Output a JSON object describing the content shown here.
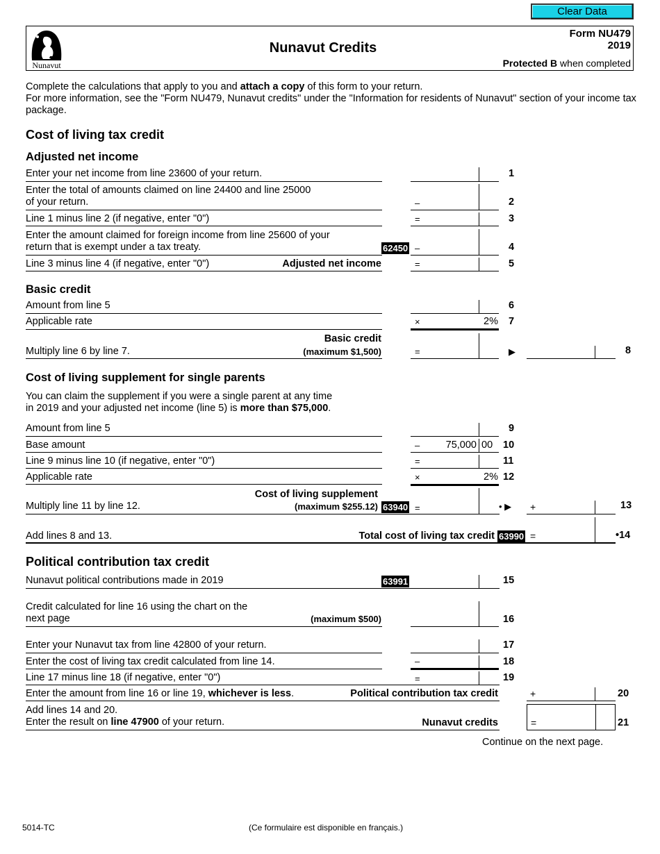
{
  "toolbar": {
    "clear_label": "Clear Data",
    "clear_color": "#1ad1e6"
  },
  "header": {
    "logo_text": "Nunavut",
    "title": "Nunavut Credits",
    "form_label": "Form NU479",
    "year": "2019",
    "protected_bold": "Protected B",
    "protected_rest": " when completed"
  },
  "intro": {
    "line1_a": "Complete the calculations that apply to you and ",
    "line1_bold": "attach a copy",
    "line1_b": " of this form to your return.",
    "line2": "For more information, see the \"Form NU479, Nunavut credits\" under the \"Information for residents of Nunavut\" section of your income tax package."
  },
  "sections": {
    "col": {
      "title": "Cost of living tax credit",
      "adj_title": "Adjusted net income",
      "basic_title": "Basic credit",
      "supp_title": "Cost of living supplement for single parents",
      "supp_desc_a": "You can claim the supplement if you were a single parent at any time",
      "supp_desc_b": "in 2019 and your adjusted net income (line 5) is ",
      "supp_desc_bold": "more than $75,000",
      "supp_desc_end": "."
    },
    "pol": {
      "title": "Political contribution tax credit"
    }
  },
  "lines": {
    "l1": {
      "num": "1",
      "label": "Enter your net income from line 23600 of your return."
    },
    "l2": {
      "num": "2",
      "label_a": "Enter the total of amounts claimed on line 24400 and line 25000",
      "label_b": "of your return.",
      "op": "–"
    },
    "l3": {
      "num": "3",
      "label": "Line 1 minus line 2 (if negative, enter \"0\")",
      "op": "="
    },
    "l4": {
      "num": "4",
      "label_a": "Enter the amount claimed for foreign income from line 25600 of your",
      "label_b": "return that is exempt under a tax treaty.",
      "code": "62450",
      "op": "–"
    },
    "l5": {
      "num": "5",
      "label": "Line 3 minus line 4 (if negative, enter \"0\")",
      "bold": "Adjusted net income",
      "op": "="
    },
    "l6": {
      "num": "6",
      "label": "Amount from line 5"
    },
    "l7": {
      "num": "7",
      "label": "Applicable rate",
      "op": "×",
      "rate": "2%"
    },
    "l8": {
      "num": "8",
      "label": "Multiply line 6 by line 7.",
      "bold_a": "Basic credit",
      "bold_b": "(maximum $1,500)",
      "op": "=",
      "arrow": "▶"
    },
    "l9": {
      "num": "9",
      "label": "Amount from line 5"
    },
    "l10": {
      "num": "10",
      "label": "Base amount",
      "op": "–",
      "value": "75,000",
      "cents": "00"
    },
    "l11": {
      "num": "11",
      "label": "Line 9 minus line 10 (if negative, enter \"0\")",
      "op": "="
    },
    "l12": {
      "num": "12",
      "label": "Applicable rate",
      "op": "×",
      "rate": "2%"
    },
    "l13": {
      "num": "13",
      "label": "Multiply line 11 by line 12.",
      "bold_a": "Cost of living supplement",
      "bold_b": "(maximum $255.12)",
      "code": "63940",
      "op": "=",
      "arrow": "• ▶",
      "op2": "+"
    },
    "l14": {
      "num": "•14",
      "label": "Add lines 8 and 13.",
      "bold": "Total cost of living tax credit",
      "code": "63990",
      "op": "="
    },
    "l15": {
      "num": "15",
      "label": "Nunavut political contributions made in 2019",
      "code": "63991"
    },
    "l16": {
      "num": "16",
      "label_a": "Credit calculated for line 16 using the chart on the",
      "label_b": "next page",
      "bold": "(maximum $500)"
    },
    "l17": {
      "num": "17",
      "label": "Enter your Nunavut tax from line 42800 of your return."
    },
    "l18": {
      "num": "18",
      "label": "Enter the cost of living tax credit calculated from line 14.",
      "op": "–"
    },
    "l19": {
      "num": "19",
      "label": "Line 17 minus line 18 (if negative, enter \"0\")",
      "op": "="
    },
    "l20": {
      "num": "20",
      "label_a": "Enter the amount from line 16 or line 19, ",
      "label_bold": "whichever is less",
      "label_end": ".",
      "bold": "Political contribution tax credit",
      "op": "+"
    },
    "l21": {
      "num": "21",
      "label_a": "Add lines 14 and 20.",
      "label_b1": "Enter the result on ",
      "label_bold": "line 47900",
      "label_b2": " of your return.",
      "bold": "Nunavut credits",
      "op": "="
    }
  },
  "continue_text": "Continue on the next page.",
  "footer": {
    "code": "5014-TC",
    "french": "(Ce formulaire est disponible en français.)"
  }
}
